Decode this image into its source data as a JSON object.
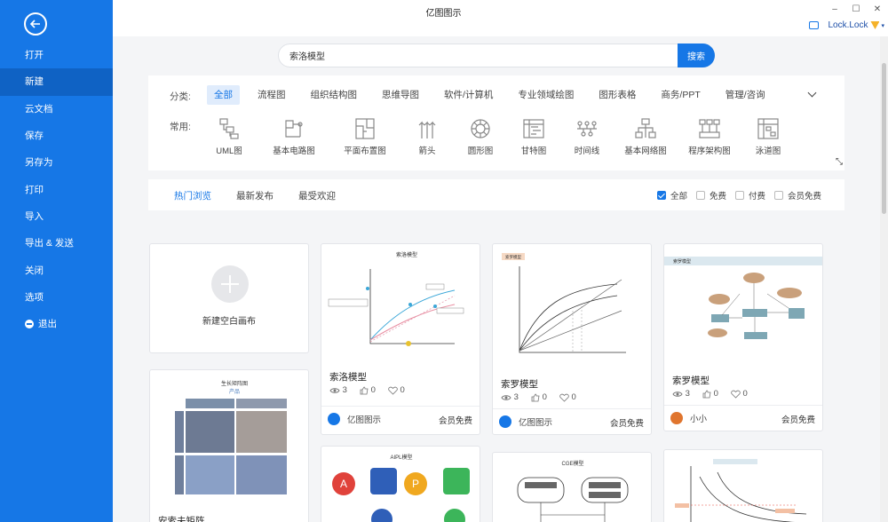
{
  "app": {
    "title": "亿图图示"
  },
  "window": {
    "minimize": "–",
    "maximize": "☐",
    "close": "✕"
  },
  "user": {
    "name": "Lock.Lock"
  },
  "sidebar": {
    "items": [
      {
        "label": "打开",
        "active": false
      },
      {
        "label": "新建",
        "active": true
      },
      {
        "label": "云文档",
        "active": false
      },
      {
        "label": "保存",
        "active": false
      },
      {
        "label": "另存为",
        "active": false
      },
      {
        "label": "打印",
        "active": false
      },
      {
        "label": "导入",
        "active": false
      },
      {
        "label": "导出 & 发送",
        "active": false
      },
      {
        "label": "关闭",
        "active": false
      },
      {
        "label": "选项",
        "active": false
      },
      {
        "label": "退出",
        "active": false
      }
    ]
  },
  "search": {
    "value": "索洛模型",
    "button": "搜索"
  },
  "categories": {
    "label": "分类:",
    "tabs": [
      "全部",
      "流程图",
      "组织结构图",
      "思维导图",
      "软件/计算机",
      "专业领域绘图",
      "图形表格",
      "商务/PPT",
      "管理/咨询"
    ],
    "active_tab": "全部",
    "common_label": "常用:",
    "common": [
      {
        "label": "UML图",
        "icon": "uml-icon"
      },
      {
        "label": "基本电路图",
        "icon": "circuit-icon"
      },
      {
        "label": "平面布置图",
        "icon": "floorplan-icon"
      },
      {
        "label": "箭头",
        "icon": "arrow-icon"
      },
      {
        "label": "圆形图",
        "icon": "circle-chart-icon"
      },
      {
        "label": "甘特图",
        "icon": "gantt-icon"
      },
      {
        "label": "时间线",
        "icon": "timeline-icon"
      },
      {
        "label": "基本网络图",
        "icon": "network-icon"
      },
      {
        "label": "程序架构图",
        "icon": "architecture-icon"
      },
      {
        "label": "泳道图",
        "icon": "swimlane-icon"
      }
    ]
  },
  "filter": {
    "tabs": [
      "热门浏览",
      "最新发布",
      "最受欢迎"
    ],
    "active_tab": "热门浏览",
    "checks": [
      {
        "label": "全部",
        "checked": true
      },
      {
        "label": "免费",
        "checked": false
      },
      {
        "label": "付费",
        "checked": false
      },
      {
        "label": "会员免费",
        "checked": false
      }
    ]
  },
  "blank_card": {
    "label": "新建空白画布"
  },
  "templates": [
    {
      "title": "索洛模型",
      "views": "3",
      "likes": "0",
      "favorites": "0",
      "author": "亿图图示",
      "price": "会员免费"
    },
    {
      "title": "索罗模型",
      "views": "3",
      "likes": "0",
      "favorites": "0",
      "author": "亿图图示",
      "price": "会员免费"
    },
    {
      "title": "索罗模型",
      "views": "3",
      "likes": "0",
      "favorites": "0",
      "author": "小小",
      "price": "会员免费"
    },
    {
      "title": "安索夫矩阵"
    }
  ],
  "thumbs": {
    "solow1": "索洛模型",
    "ansoff_title": "生长矩阵图",
    "ansoff_sub": "产品",
    "aipl": "AIPL模型",
    "cge": "CGE模型",
    "third_tag": "索罗模型"
  }
}
